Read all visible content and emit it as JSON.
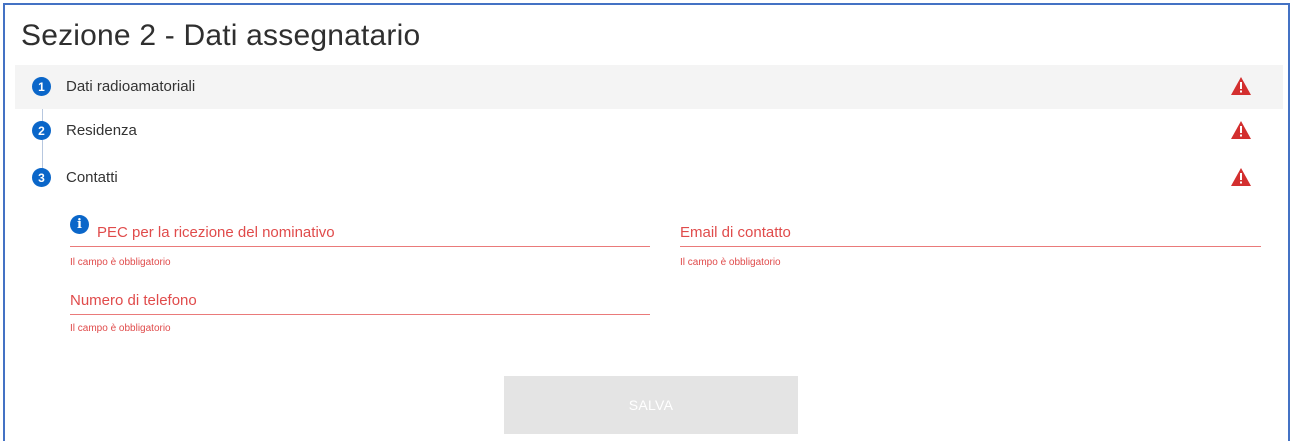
{
  "section": {
    "title": "Sezione 2 - Dati assegnatario"
  },
  "steps": [
    {
      "number": "1",
      "label": "Dati radioamatoriali",
      "status_icon": "warning-icon",
      "active": true
    },
    {
      "number": "2",
      "label": "Residenza",
      "status_icon": "warning-icon",
      "active": false
    },
    {
      "number": "3",
      "label": "Contatti",
      "status_icon": "warning-icon",
      "active": false
    }
  ],
  "form": {
    "info_icon": "i",
    "pec": {
      "label": "PEC per la ricezione del nominativo",
      "error": "Il campo è obbligatorio"
    },
    "email": {
      "label": "Email di contatto",
      "error": "Il campo è obbligatorio"
    },
    "phone": {
      "label": "Numero di telefono",
      "error": "Il campo è obbligatorio"
    },
    "save_label": "SALVA"
  },
  "colors": {
    "accent": "#0a66c9",
    "error": "#e04b4b",
    "warning": "#d32f2f",
    "border": "#4472c4"
  }
}
